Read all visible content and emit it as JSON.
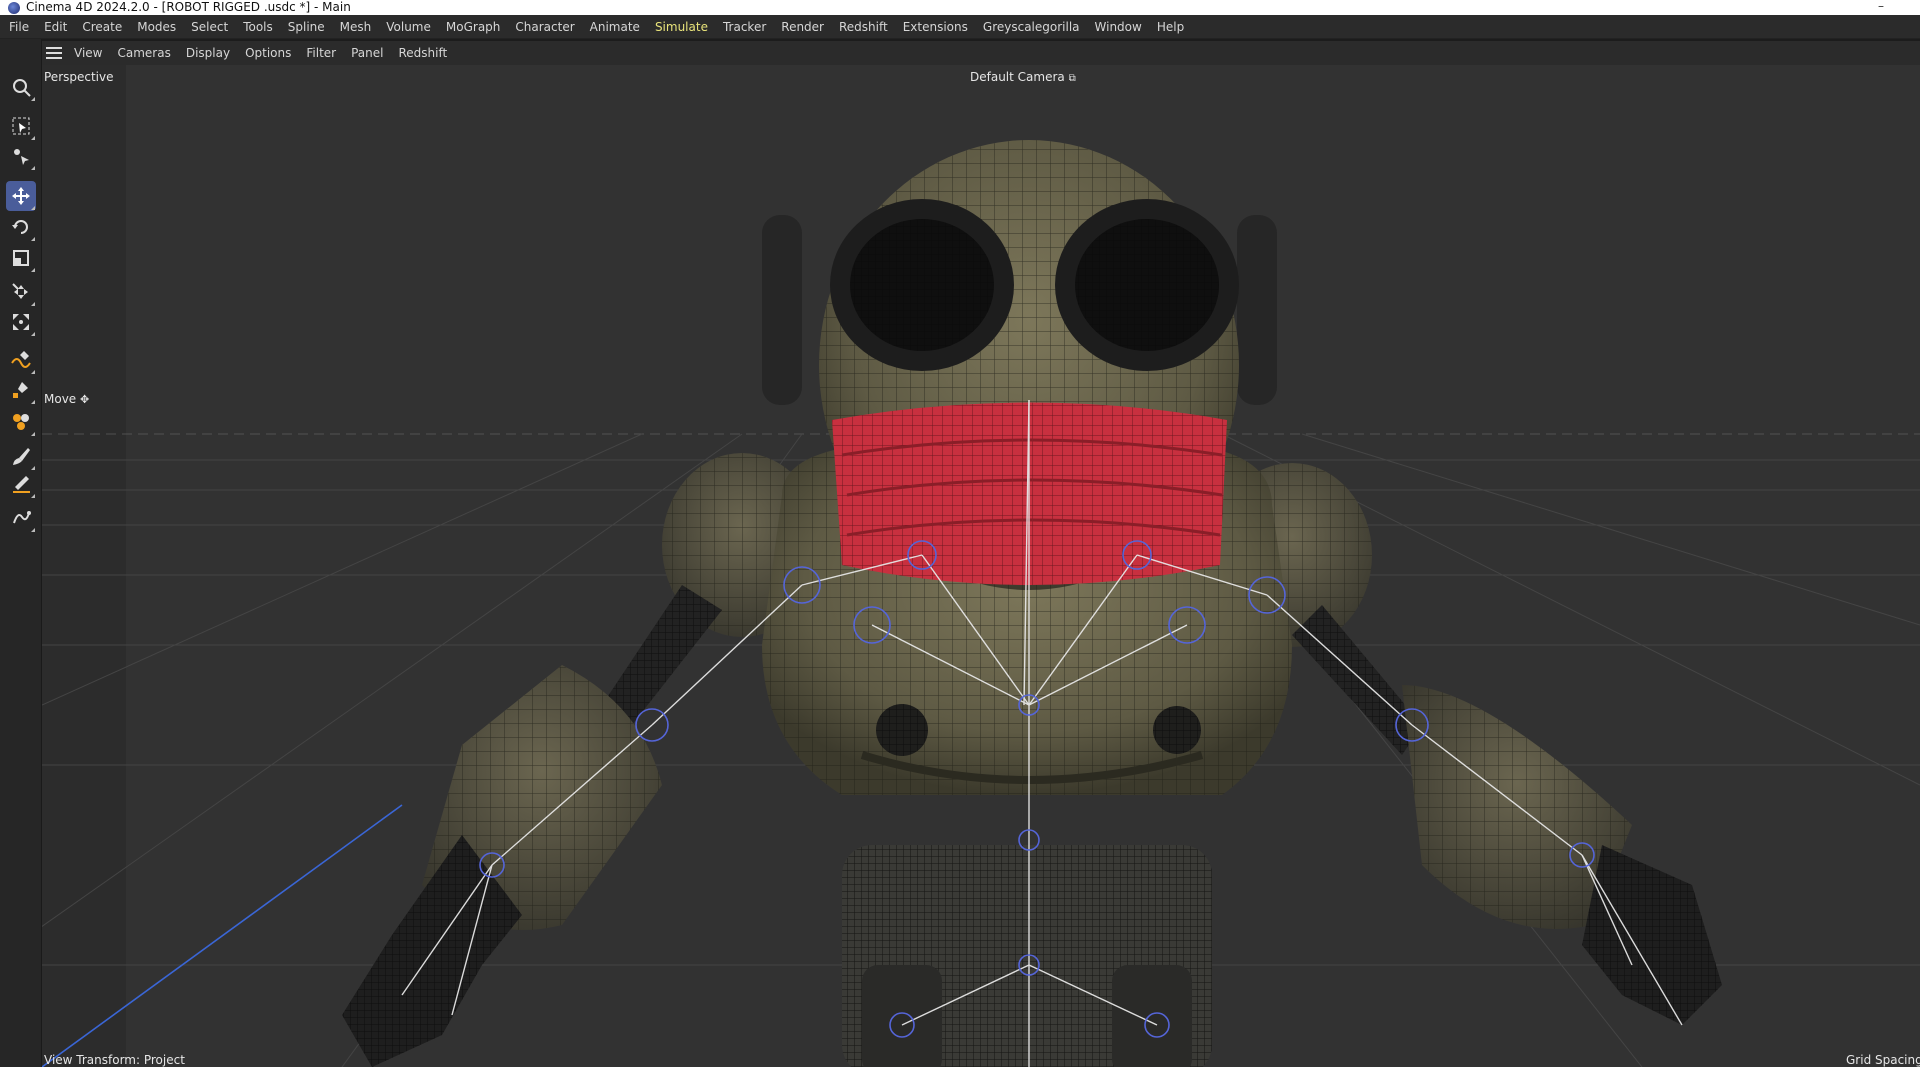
{
  "window": {
    "title": "Cinema 4D 2024.2.0 - [ROBOT RIGGED .usdc *] - Main",
    "minimize_glyph": "–"
  },
  "menubar": {
    "items": [
      "File",
      "Edit",
      "Create",
      "Modes",
      "Select",
      "Tools",
      "Spline",
      "Mesh",
      "Volume",
      "MoGraph",
      "Character",
      "Animate",
      "Simulate",
      "Tracker",
      "Render",
      "Redshift",
      "Extensions",
      "Greyscalegorilla",
      "Window",
      "Help"
    ],
    "active": "Simulate",
    "active_color": "#e8e37a"
  },
  "viewport_menu": {
    "items": [
      "View",
      "Cameras",
      "Display",
      "Options",
      "Filter",
      "Panel",
      "Redshift"
    ]
  },
  "viewport": {
    "projection": "Perspective",
    "camera": "Default Camera",
    "camera_icon": "camera-link-icon",
    "tool_label": "Move",
    "tool_icon": "move-cross-icon",
    "view_transform": "View Transform: Project",
    "grid_spacing": "Grid Spacing"
  },
  "toolbar": {
    "tools": [
      {
        "name": "search-icon"
      },
      {
        "name": "live-selection-icon"
      },
      {
        "name": "tweak-icon"
      },
      {
        "name": "move-icon",
        "selected": true
      },
      {
        "name": "rotate-icon"
      },
      {
        "name": "scale-icon"
      },
      {
        "name": "mesh-move-icon"
      },
      {
        "name": "mesh-scale-icon"
      },
      {
        "name": "spline-pen-icon"
      },
      {
        "name": "spline-sketch-icon"
      },
      {
        "name": "deformer-icon"
      },
      {
        "name": "brush-icon"
      },
      {
        "name": "knife-icon"
      },
      {
        "name": "spline-smooth-icon"
      }
    ],
    "selected_color": "#4a5d9a"
  },
  "scene": {
    "background": "#323232",
    "robot_body_color": "#6f6a50",
    "scarf_color": "#c8303f",
    "joint_color": "#5565d8"
  }
}
